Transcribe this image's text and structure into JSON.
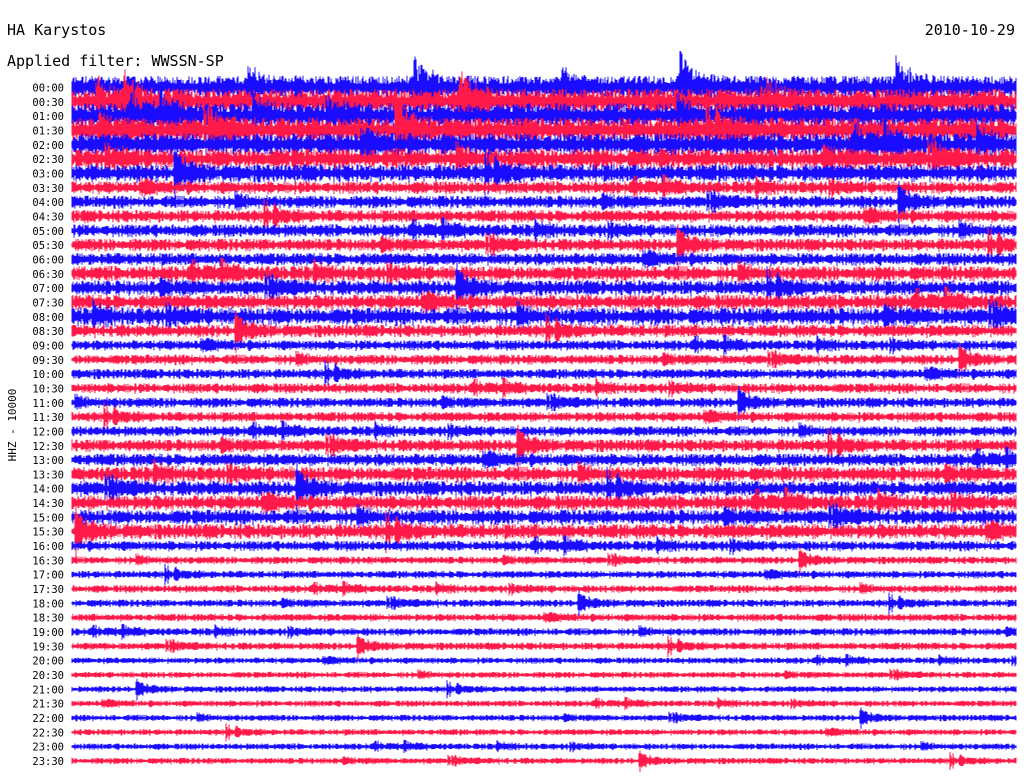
{
  "header": {
    "station": "HA Karystos",
    "date": "2010-10-29",
    "filter": "Applied filter: WWSSN-SP"
  },
  "chart_data": {
    "type": "helicorder",
    "channel_label": "HHZ - 10000",
    "colors": [
      "#1a0dff",
      "#ff1a4a"
    ],
    "rows": [
      {
        "label": "00:00",
        "color": "#1a0dff",
        "noise": 9
      },
      {
        "label": "00:30",
        "color": "#ff1a4a",
        "noise": 10
      },
      {
        "label": "01:00",
        "color": "#1a0dff",
        "noise": 10
      },
      {
        "label": "01:30",
        "color": "#ff1a4a",
        "noise": 10
      },
      {
        "label": "02:00",
        "color": "#1a0dff",
        "noise": 9
      },
      {
        "label": "02:30",
        "color": "#ff1a4a",
        "noise": 8
      },
      {
        "label": "03:00",
        "color": "#1a0dff",
        "noise": 7
      },
      {
        "label": "03:30",
        "color": "#ff1a4a",
        "noise": 5
      },
      {
        "label": "04:00",
        "color": "#1a0dff",
        "noise": 5
      },
      {
        "label": "04:30",
        "color": "#ff1a4a",
        "noise": 5
      },
      {
        "label": "05:00",
        "color": "#1a0dff",
        "noise": 5
      },
      {
        "label": "05:30",
        "color": "#ff1a4a",
        "noise": 5
      },
      {
        "label": "06:00",
        "color": "#1a0dff",
        "noise": 5
      },
      {
        "label": "06:30",
        "color": "#ff1a4a",
        "noise": 6
      },
      {
        "label": "07:00",
        "color": "#1a0dff",
        "noise": 6
      },
      {
        "label": "07:30",
        "color": "#ff1a4a",
        "noise": 6
      },
      {
        "label": "08:00",
        "color": "#1a0dff",
        "noise": 7
      },
      {
        "label": "08:30",
        "color": "#ff1a4a",
        "noise": 5
      },
      {
        "label": "09:00",
        "color": "#1a0dff",
        "noise": 4
      },
      {
        "label": "09:30",
        "color": "#ff1a4a",
        "noise": 4
      },
      {
        "label": "10:00",
        "color": "#1a0dff",
        "noise": 4
      },
      {
        "label": "10:30",
        "color": "#ff1a4a",
        "noise": 4
      },
      {
        "label": "11:00",
        "color": "#1a0dff",
        "noise": 4
      },
      {
        "label": "11:30",
        "color": "#ff1a4a",
        "noise": 4
      },
      {
        "label": "12:00",
        "color": "#1a0dff",
        "noise": 4
      },
      {
        "label": "12:30",
        "color": "#ff1a4a",
        "noise": 5
      },
      {
        "label": "13:00",
        "color": "#1a0dff",
        "noise": 5
      },
      {
        "label": "13:30",
        "color": "#ff1a4a",
        "noise": 6
      },
      {
        "label": "14:00",
        "color": "#1a0dff",
        "noise": 6
      },
      {
        "label": "14:30",
        "color": "#ff1a4a",
        "noise": 6
      },
      {
        "label": "15:00",
        "color": "#1a0dff",
        "noise": 6
      },
      {
        "label": "15:30",
        "color": "#ff1a4a",
        "noise": 6
      },
      {
        "label": "16:00",
        "color": "#1a0dff",
        "noise": 4
      },
      {
        "label": "16:30",
        "color": "#ff1a4a",
        "noise": 3
      },
      {
        "label": "17:00",
        "color": "#1a0dff",
        "noise": 3
      },
      {
        "label": "17:30",
        "color": "#ff1a4a",
        "noise": 3
      },
      {
        "label": "18:00",
        "color": "#1a0dff",
        "noise": 3
      },
      {
        "label": "18:30",
        "color": "#ff1a4a",
        "noise": 3
      },
      {
        "label": "19:00",
        "color": "#1a0dff",
        "noise": 3
      },
      {
        "label": "19:30",
        "color": "#ff1a4a",
        "noise": 3
      },
      {
        "label": "20:00",
        "color": "#1a0dff",
        "noise": 2.5
      },
      {
        "label": "20:30",
        "color": "#ff1a4a",
        "noise": 2.5
      },
      {
        "label": "21:00",
        "color": "#1a0dff",
        "noise": 2.5
      },
      {
        "label": "21:30",
        "color": "#ff1a4a",
        "noise": 2.5
      },
      {
        "label": "22:00",
        "color": "#1a0dff",
        "noise": 2.5
      },
      {
        "label": "22:30",
        "color": "#ff1a4a",
        "noise": 2.5
      },
      {
        "label": "23:00",
        "color": "#1a0dff",
        "noise": 2.5
      },
      {
        "label": "23:30",
        "color": "#ff1a4a",
        "noise": 2.5
      }
    ]
  }
}
